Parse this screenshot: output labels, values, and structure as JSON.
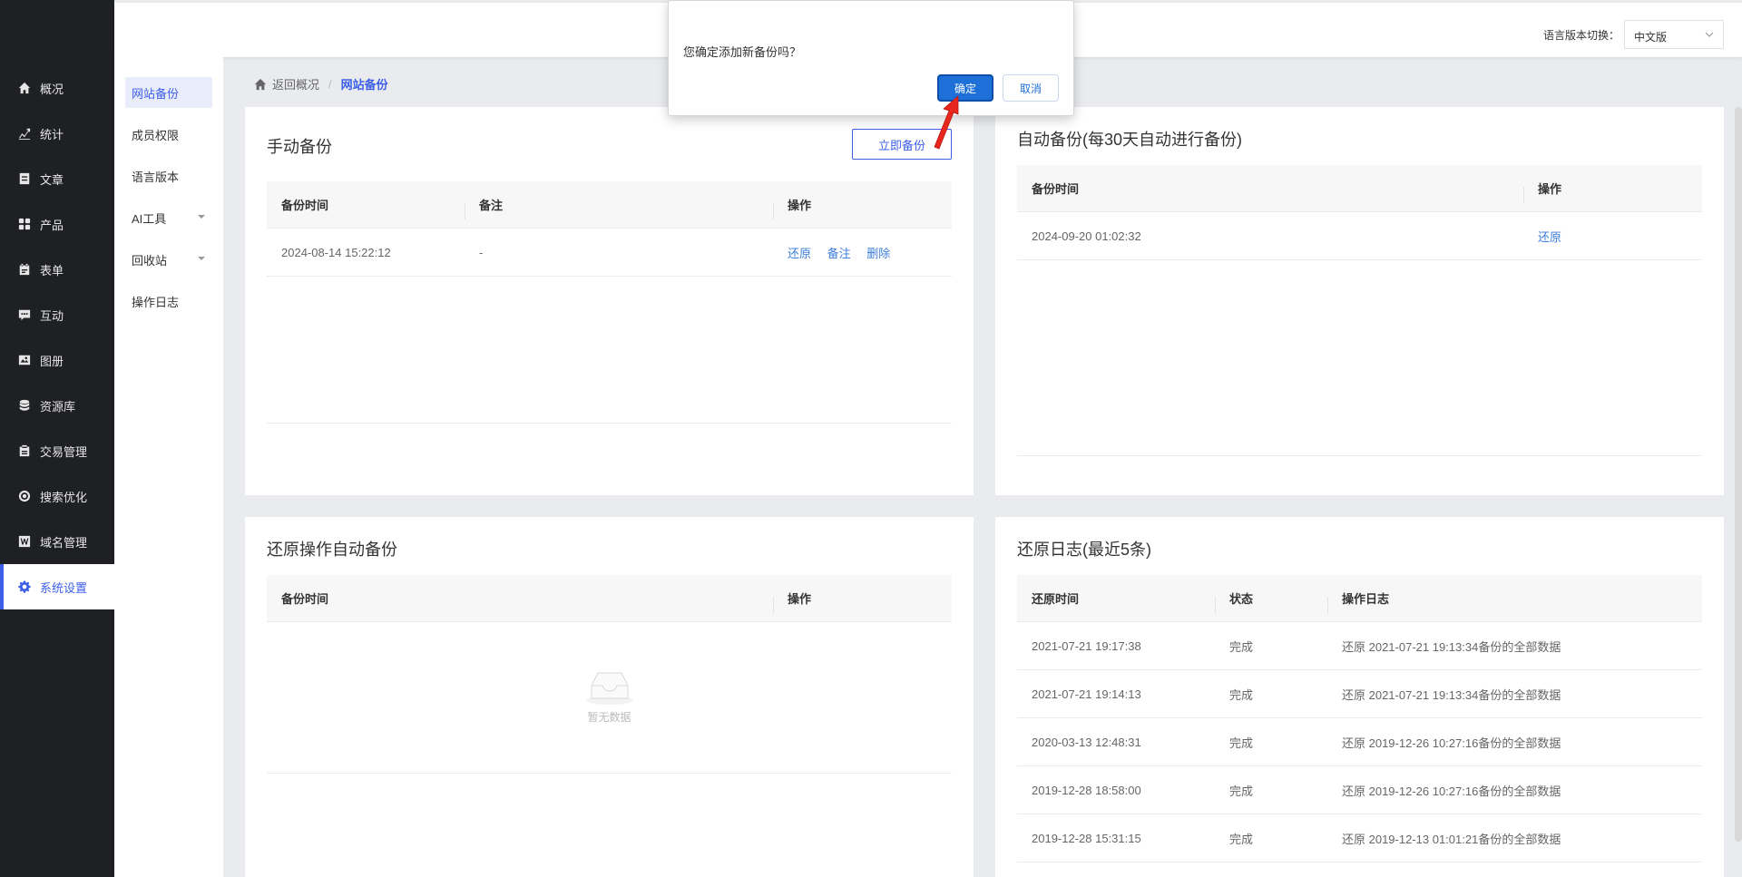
{
  "sidebar": {
    "items": [
      {
        "label": "概况",
        "icon": "home-icon"
      },
      {
        "label": "统计",
        "icon": "chart-icon"
      },
      {
        "label": "文章",
        "icon": "article-icon"
      },
      {
        "label": "产品",
        "icon": "grid-icon"
      },
      {
        "label": "表单",
        "icon": "form-icon"
      },
      {
        "label": "互动",
        "icon": "chat-icon"
      },
      {
        "label": "图册",
        "icon": "gallery-icon"
      },
      {
        "label": "资源库",
        "icon": "database-icon"
      },
      {
        "label": "交易管理",
        "icon": "clipboard-icon"
      },
      {
        "label": "搜索优化",
        "icon": "seo-icon"
      },
      {
        "label": "域名管理",
        "icon": "w-icon"
      },
      {
        "label": "系统设置",
        "icon": "gear-icon"
      }
    ]
  },
  "topbar": {
    "lang_label": "语言版本切换：",
    "lang_value": "中文版"
  },
  "subnav": {
    "items": [
      {
        "label": "网站备份"
      },
      {
        "label": "成员权限"
      },
      {
        "label": "语言版本"
      },
      {
        "label": "AI工具"
      },
      {
        "label": "回收站"
      },
      {
        "label": "操作日志"
      }
    ]
  },
  "breadcrumb": {
    "back": "返回概况",
    "sep": "/",
    "current": "网站备份"
  },
  "manual": {
    "title": "手动备份",
    "button": "立即备份",
    "headers": [
      "备份时间",
      "备注",
      "操作"
    ],
    "rows": [
      {
        "time": "2024-08-14 15:22:12",
        "note": "-",
        "actions": [
          "还原",
          "备注",
          "删除"
        ]
      }
    ]
  },
  "auto": {
    "title": "自动备份(每30天自动进行备份)",
    "headers": [
      "备份时间",
      "操作"
    ],
    "rows": [
      {
        "time": "2024-09-20 01:02:32",
        "action": "还原"
      }
    ]
  },
  "restore_auto": {
    "title": "还原操作自动备份",
    "headers": [
      "备份时间",
      "操作"
    ],
    "empty": "暂无数据"
  },
  "restore_log": {
    "title": "还原日志(最近5条)",
    "headers": [
      "还原时间",
      "状态",
      "操作日志"
    ],
    "rows": [
      {
        "time": "2021-07-21 19:17:38",
        "status": "完成",
        "log": "还原 2021-07-21 19:13:34备份的全部数据"
      },
      {
        "time": "2021-07-21 19:14:13",
        "status": "完成",
        "log": "还原 2021-07-21 19:13:34备份的全部数据"
      },
      {
        "time": "2020-03-13 12:48:31",
        "status": "完成",
        "log": "还原 2019-12-26 10:27:16备份的全部数据"
      },
      {
        "time": "2019-12-28 18:58:00",
        "status": "完成",
        "log": "还原 2019-12-26 10:27:16备份的全部数据"
      },
      {
        "time": "2019-12-28 15:31:15",
        "status": "完成",
        "log": "还原 2019-12-13 01:01:21备份的全部数据"
      }
    ]
  },
  "dialog": {
    "message": "您确定添加新备份吗？",
    "ok": "确定",
    "cancel": "取消"
  },
  "colors": {
    "accent": "#3d5ee6",
    "link": "#3d7ddb",
    "sidebar_bg": "#1f2024",
    "dialog_ok": "#1e6fd8",
    "annotation_arrow": "#e8261e"
  }
}
